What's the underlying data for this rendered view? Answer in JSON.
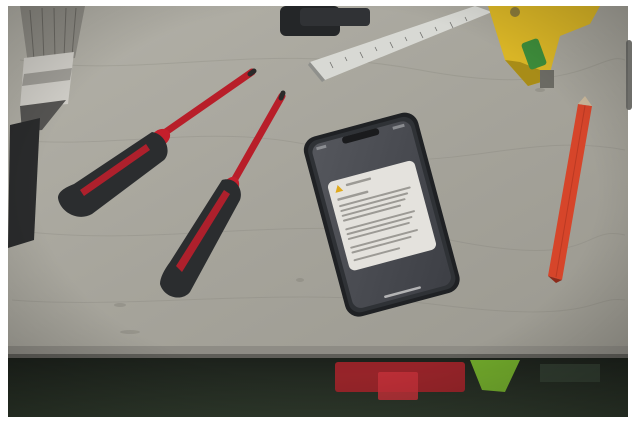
{
  "photo": {
    "colors": {
      "page_background": "#ffffff",
      "table_top": "#a6a49b",
      "table_edge": "#7d7b74",
      "floor_shadow": "#2a3126",
      "screwdriver_handle": "#2b2d2f",
      "screwdriver_accent": "#c51f2c",
      "pencil": "#d6452a",
      "ruler": "#d8d9d4",
      "square_body": "#d9b526",
      "phone_body": "#2f3236",
      "phone_screen": "#4a4c52",
      "notification_card": "#e4e2dd"
    },
    "objects": [
      "paint-brush",
      "red-screwdriver-left",
      "red-screwdriver-right",
      "metal-ruler",
      "combination-square",
      "carpenter-pencil",
      "smartphone"
    ]
  }
}
